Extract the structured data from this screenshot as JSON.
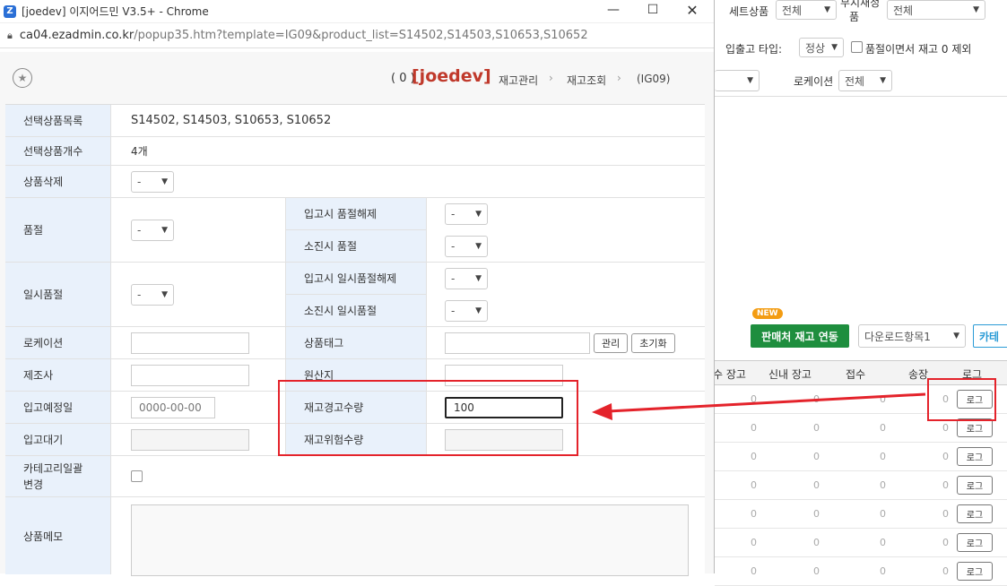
{
  "window": {
    "title": "[joedev] 이지어드민 V3.5+ - Chrome",
    "app_icon": "Z",
    "url_host": "ca04.ezadmin.co.kr",
    "url_path": "/popup35.htm?template=IG09&product_list=S14502,S14503,S10653,S10652"
  },
  "header": {
    "count": "( 0 )",
    "brand": "[joedev]",
    "breadcrumb": [
      "재고관리",
      "재고조회",
      "(IG09)"
    ]
  },
  "form": {
    "selected_list_label": "선택상품목록",
    "selected_list_value": "S14502, S14503, S10653, S10652",
    "selected_count_label": "선택상품개수",
    "selected_count_value": "4개",
    "delete_label": "상품삭제",
    "soldout_label": "품절",
    "soldout_release_label": "입고시 품절해제",
    "soldout_exhaust_label": "소진시 품절",
    "temp_soldout_label": "일시품절",
    "temp_release_label": "입고시 일시품절해제",
    "temp_exhaust_label": "소진시 일시품절",
    "location_label": "로케이션",
    "tag_label": "상품태그",
    "manage_button": "관리",
    "reset_button": "초기화",
    "maker_label": "제조사",
    "origin_label": "원산지",
    "expected_label": "입고예정일",
    "expected_value": "0000-00-00",
    "warn_label": "재고경고수량",
    "warn_value": "100",
    "wait_label": "입고대기",
    "danger_label": "재고위험수량",
    "category_label_1": "카테고리일괄",
    "category_label_2": "변경",
    "memo_label": "상품메모",
    "dash": "-"
  },
  "background": {
    "set_product_label": "세트상품",
    "set_product_value": "전체",
    "cut_label_1": "부지재정",
    "cut_label_2": "품",
    "cut_value": "전체",
    "io_type_label": "입출고 타입:",
    "io_type_value": "정상",
    "exclude_label": "품절이면서 재고 0 제외",
    "location_label": "로케이션",
    "location_value": "전체",
    "new_badge": "NEW",
    "sync_button": "판매처 재고 연동",
    "download_value": "다운로드항목1",
    "category_button": "카테",
    "columns": [
      "수 장고",
      "신내 장고",
      "접수",
      "송장",
      "로그"
    ],
    "zero": "0",
    "log_button": "로그"
  },
  "colors": {
    "accent_red": "#e4232b",
    "brand_red": "#c0392b",
    "label_bg": "#e9f1fb",
    "sync_green": "#1e8e3e"
  }
}
